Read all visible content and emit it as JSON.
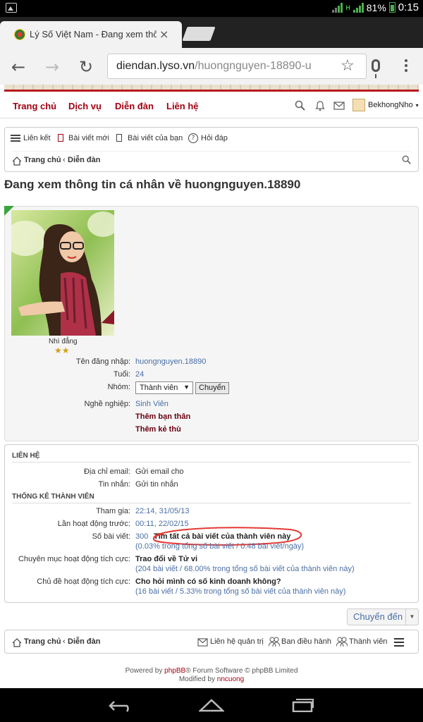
{
  "status_bar": {
    "battery": "81%",
    "time": "0:15",
    "net_type": "H"
  },
  "tab": {
    "title": "Lý Số Việt Nam - Đang xem thông",
    "close": "×"
  },
  "address": {
    "domain": "diendan.lyso.vn",
    "path": "/huongnguyen-18890-u"
  },
  "topnav": {
    "items": [
      "Trang chủ",
      "Dịch vụ",
      "Diễn đàn",
      "Liên hệ"
    ],
    "username": "BekhongNho"
  },
  "toolbar": {
    "links": [
      "Liên kết",
      "Bài viết mới",
      "Bài viết của bạn",
      "Hỏi đáp"
    ]
  },
  "breadcrumb": {
    "home": "Trang chủ",
    "forum": "Diễn đàn"
  },
  "page_title": "Đang xem thông tin cá nhân về huongnguyen.18890",
  "profile": {
    "rank": "Nhì đẳng",
    "stars": "★★",
    "username_label": "Tên đăng nhập:",
    "username": "huongnguyen.18890",
    "age_label": "Tuổi:",
    "age": "24",
    "group_label": "Nhóm:",
    "group_selected": "Thành viên",
    "group_button": "Chuyển",
    "job_label": "Nghề nghiệp:",
    "job": "Sinh Viên",
    "add_friend": "Thêm bạn thân",
    "add_foe": "Thêm kẻ thù"
  },
  "contact": {
    "heading": "LIÊN HỆ",
    "email_label": "Địa chỉ email:",
    "email_value": "Gửi email cho",
    "pm_label": "Tin nhắn:",
    "pm_value": "Gửi tin nhắn"
  },
  "stats": {
    "heading": "THỐNG KÊ THÀNH VIÊN",
    "joined_label": "Tham gia:",
    "joined": "22:14, 31/05/13",
    "last_active_label": "Lần hoạt động trước:",
    "last_active": "00:11, 22/02/15",
    "posts_label": "Số bài viết:",
    "posts": "300",
    "posts_search": "Tìm tất cả bài viết của thành viên này",
    "posts_detail": "(0.03% trong tổng số bài viết / 0.48 bài viết/ngày)",
    "active_forum_label": "Chuyên mục hoạt động tích cực:",
    "active_forum": "Trao đổi về Tử vi",
    "active_forum_detail": "(204 bài viết / 68.00% trong tổng số bài viết của thành viên này)",
    "active_topic_label": "Chủ đề hoạt động tích cực:",
    "active_topic": "Cho hỏi mình có số kinh doanh không?",
    "active_topic_detail": "(16 bài viết / 5.33% trong tổng số bài viết của thành viên này)"
  },
  "jump_button": "Chuyển đến",
  "footer_bar": {
    "home": "Trang chủ",
    "forum": "Diễn đàn",
    "contact_admin": "Liên hệ quản trị",
    "team": "Ban điều hành",
    "members": "Thành viên"
  },
  "credits": {
    "line1a": "Powered by ",
    "line1b": "phpBB",
    "line1c": "® Forum Software © phpBB Limited",
    "line2a": "Modified by ",
    "line2b": "nncuong"
  },
  "colors": {
    "brand": "#a30010",
    "link": "#4a6fa5"
  }
}
